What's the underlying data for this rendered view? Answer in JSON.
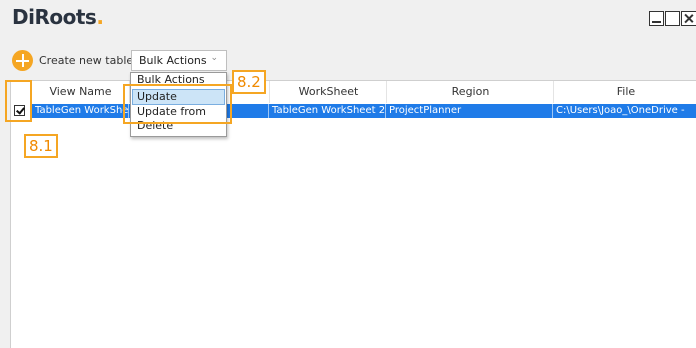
{
  "app": {
    "logo_text": "DiRoots",
    "logo_dot": "."
  },
  "toolbar": {
    "create_label": "Create new table",
    "bulk_actions_value": "Bulk Actions",
    "chevron": "⌄"
  },
  "dropdown": {
    "options": [
      "Bulk Actions",
      "Update",
      "Update from",
      "Delete"
    ],
    "highlighted": "Update"
  },
  "table": {
    "columns": [
      "View Name",
      "",
      "WorkSheet",
      "Region",
      "File"
    ],
    "rows": [
      {
        "selected": true,
        "checked": true,
        "cells": [
          "TableGen WorkShe",
          "",
          "TableGen WorkSheet 2",
          "ProjectPlanner",
          "C:\\Users\\Joao_\\OneDrive -"
        ]
      }
    ]
  },
  "annotations": {
    "callout_1": "8.1",
    "callout_2": "8.2",
    "color": "#f5a623"
  },
  "colors": {
    "accent": "#f5a623",
    "selection": "#1f7be8",
    "highlight": "#cce4f7"
  }
}
